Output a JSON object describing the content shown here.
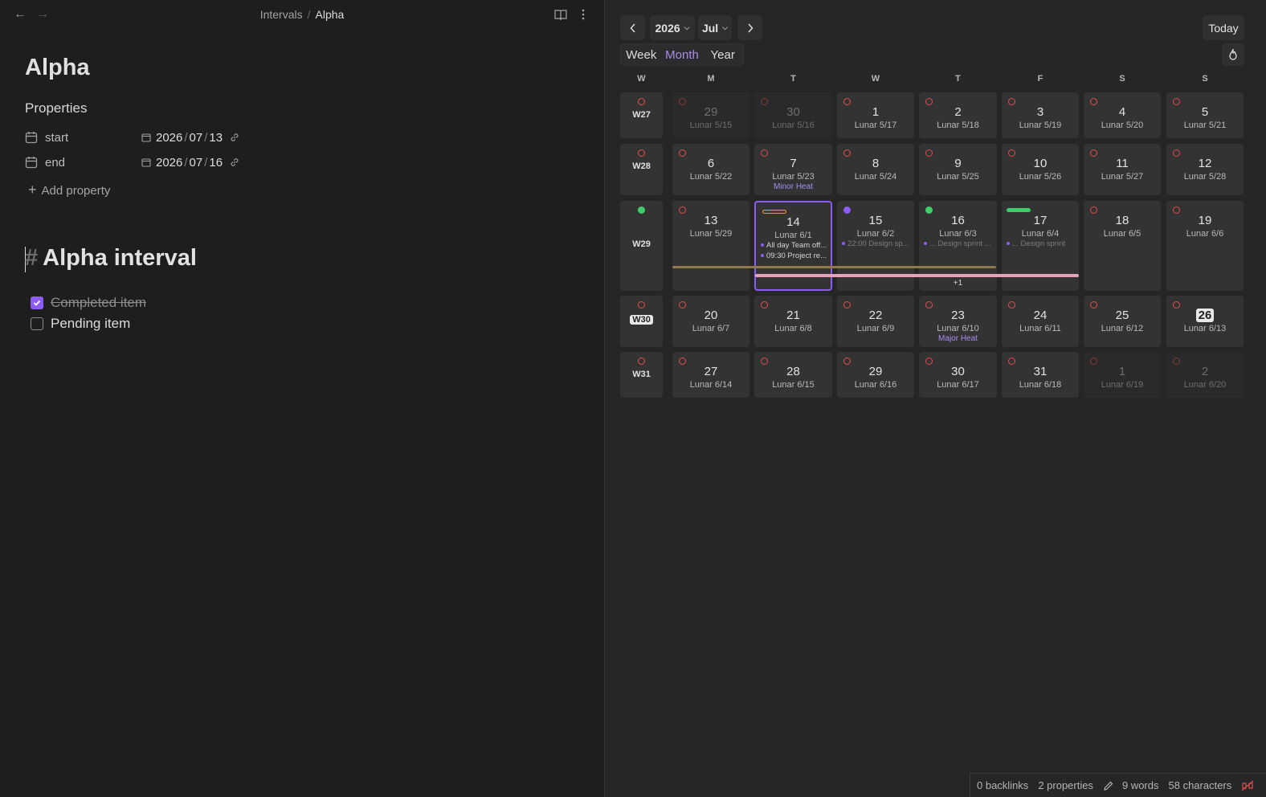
{
  "breadcrumb": {
    "parent": "Intervals",
    "separator": "/",
    "current": "Alpha"
  },
  "note": {
    "title": "Alpha",
    "properties_heading": "Properties",
    "properties": [
      {
        "key": "start",
        "y": "2026",
        "m": "07",
        "d": "13"
      },
      {
        "key": "end",
        "y": "2026",
        "m": "07",
        "d": "16"
      }
    ],
    "add_property": "Add property",
    "heading_marker": "#",
    "heading": "Alpha interval",
    "tasks": [
      {
        "label": "Completed item",
        "checked": true
      },
      {
        "label": "Pending item",
        "checked": false
      }
    ]
  },
  "calendar": {
    "year": "2026",
    "month": "Jul",
    "today_button": "Today",
    "views": [
      "Week",
      "Month",
      "Year"
    ],
    "active_view": "Month",
    "weekday_header": [
      "W",
      "M",
      "T",
      "W",
      "T",
      "F",
      "S",
      "S"
    ],
    "weeks": [
      {
        "label": "W27",
        "marker": "ring",
        "days": [
          {
            "n": "29",
            "lunar": "Lunar 5/15",
            "faded": true
          },
          {
            "n": "30",
            "lunar": "Lunar 5/16",
            "faded": true
          },
          {
            "n": "1",
            "lunar": "Lunar 5/17"
          },
          {
            "n": "2",
            "lunar": "Lunar 5/18"
          },
          {
            "n": "3",
            "lunar": "Lunar 5/19"
          },
          {
            "n": "4",
            "lunar": "Lunar 5/20"
          },
          {
            "n": "5",
            "lunar": "Lunar 5/21"
          }
        ]
      },
      {
        "label": "W28",
        "marker": "ring",
        "days": [
          {
            "n": "6",
            "lunar": "Lunar 5/22"
          },
          {
            "n": "7",
            "lunar": "Lunar 5/23",
            "term": "Minor Heat"
          },
          {
            "n": "8",
            "lunar": "Lunar 5/24"
          },
          {
            "n": "9",
            "lunar": "Lunar 5/25"
          },
          {
            "n": "10",
            "lunar": "Lunar 5/26"
          },
          {
            "n": "11",
            "lunar": "Lunar 5/27"
          },
          {
            "n": "12",
            "lunar": "Lunar 5/28"
          }
        ]
      },
      {
        "label": "W29",
        "marker": "green",
        "days": [
          {
            "n": "13",
            "lunar": "Lunar 5/29"
          },
          {
            "n": "14",
            "lunar": "Lunar 6/1",
            "selected": true,
            "marker": "bar-orange",
            "events": [
              "All day Team off...",
              "09:30 Project re..."
            ]
          },
          {
            "n": "15",
            "lunar": "Lunar 6/2",
            "marker": "purple",
            "events": [
              "22:00 Design sp..."
            ],
            "dim_events": true
          },
          {
            "n": "16",
            "lunar": "Lunar 6/3",
            "marker": "green",
            "events": [
              "... Design sprint ..."
            ],
            "dim_events": true,
            "more": "+1"
          },
          {
            "n": "17",
            "lunar": "Lunar 6/4",
            "marker": "bar-green",
            "events": [
              "... Design sprint"
            ],
            "dim_events": true
          },
          {
            "n": "18",
            "lunar": "Lunar 6/5"
          },
          {
            "n": "19",
            "lunar": "Lunar 6/6"
          }
        ]
      },
      {
        "label": "W30",
        "marker": "ring",
        "current": true,
        "days": [
          {
            "n": "20",
            "lunar": "Lunar 6/7"
          },
          {
            "n": "21",
            "lunar": "Lunar 6/8"
          },
          {
            "n": "22",
            "lunar": "Lunar 6/9"
          },
          {
            "n": "23",
            "lunar": "Lunar 6/10",
            "term": "Major Heat"
          },
          {
            "n": "24",
            "lunar": "Lunar 6/11"
          },
          {
            "n": "25",
            "lunar": "Lunar 6/12"
          },
          {
            "n": "26",
            "lunar": "Lunar 6/13",
            "today": true
          }
        ]
      },
      {
        "label": "W31",
        "marker": "ring",
        "days": [
          {
            "n": "27",
            "lunar": "Lunar 6/14"
          },
          {
            "n": "28",
            "lunar": "Lunar 6/15"
          },
          {
            "n": "29",
            "lunar": "Lunar 6/16"
          },
          {
            "n": "30",
            "lunar": "Lunar 6/17"
          },
          {
            "n": "31",
            "lunar": "Lunar 6/18"
          },
          {
            "n": "1",
            "lunar": "Lunar 6/19",
            "faded": true
          },
          {
            "n": "2",
            "lunar": "Lunar 6/20",
            "faded": true
          }
        ]
      }
    ]
  },
  "status": {
    "backlinks": "0 backlinks",
    "properties": "2 properties",
    "words": "9 words",
    "characters": "58 characters"
  },
  "colors": {
    "accent": "#8b5cf6",
    "ring": "#e24c4c",
    "green": "#3ecf6a",
    "orange": "#e89a3c",
    "pink": "#e8a1b8",
    "olive": "#8c7a4c"
  },
  "icons": [
    "back-arrow-icon",
    "forward-arrow-icon",
    "book-icon",
    "more-vertical-icon",
    "calendar-icon",
    "link-icon",
    "plus-icon",
    "chevron-left-icon",
    "chevron-right-icon",
    "chevron-down-icon",
    "flame-icon",
    "pencil-icon",
    "sync-off-icon"
  ]
}
